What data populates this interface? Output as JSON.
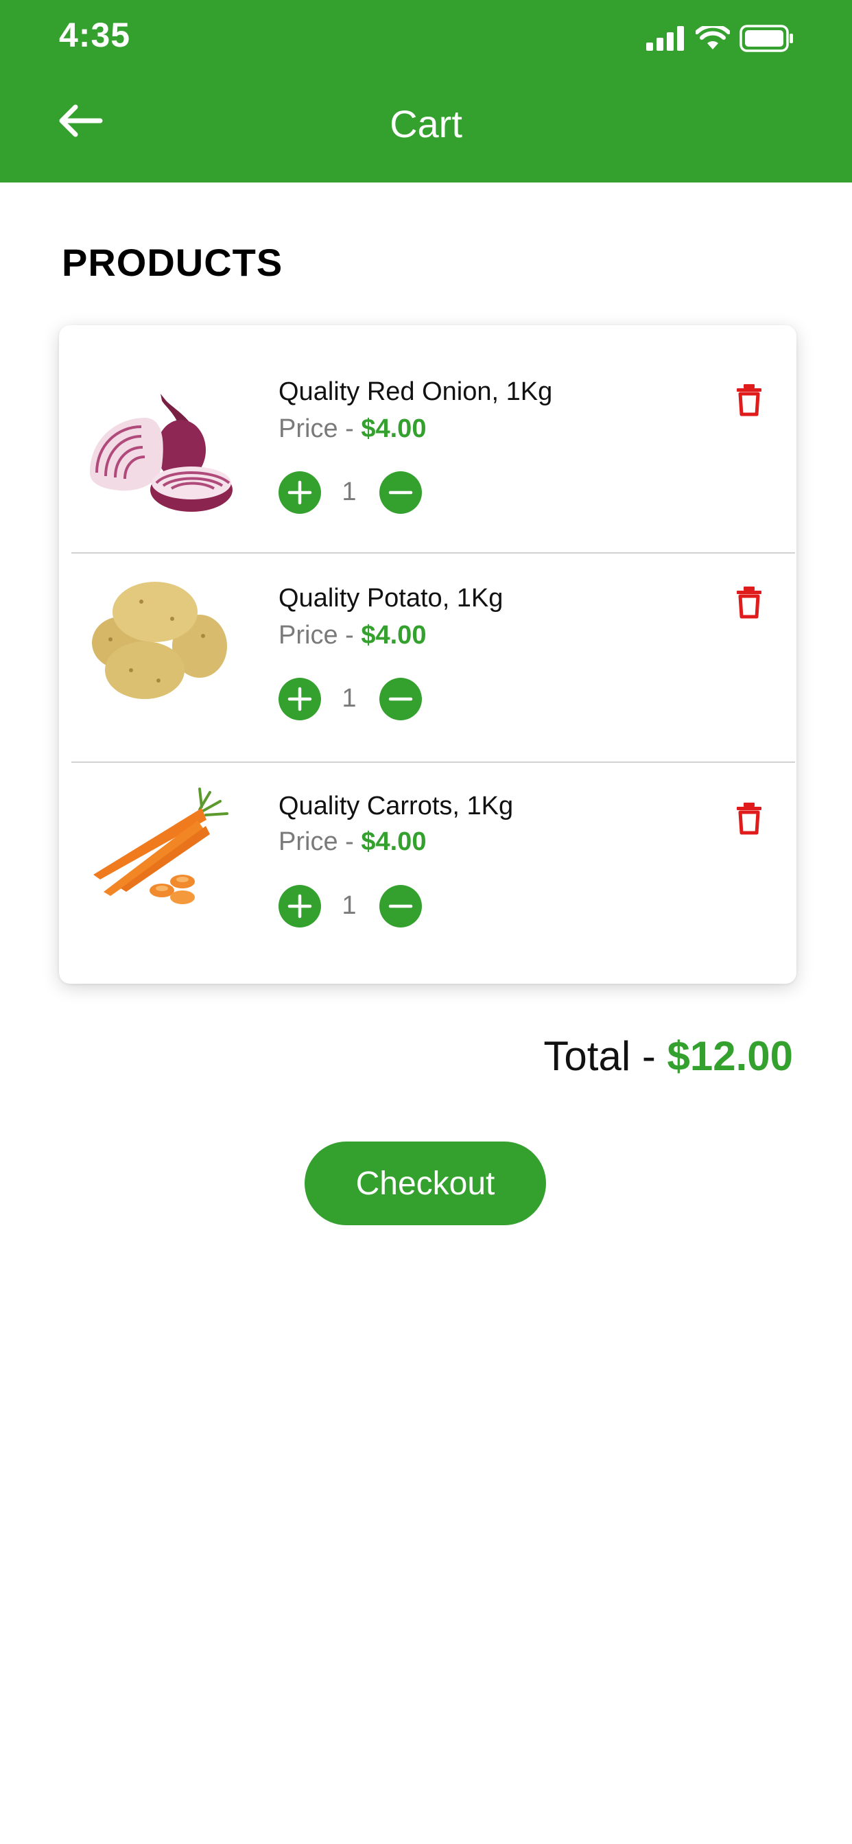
{
  "status_bar": {
    "time": "4:35"
  },
  "header": {
    "title": "Cart",
    "back_icon": "arrow-left-icon"
  },
  "section": {
    "title": "PRODUCTS"
  },
  "products": [
    {
      "name": "Quality Red Onion, 1Kg",
      "price_label": "Price - ",
      "price": "$4.00",
      "quantity": "1",
      "image": "red-onion-image"
    },
    {
      "name": "Quality Potato, 1Kg",
      "price_label": "Price - ",
      "price": "$4.00",
      "quantity": "1",
      "image": "potato-image"
    },
    {
      "name": "Quality Carrots, 1Kg",
      "price_label": "Price - ",
      "price": "$4.00",
      "quantity": "1",
      "image": "carrot-image"
    }
  ],
  "summary": {
    "total_label": "Total - ",
    "total_value": "$12.00"
  },
  "actions": {
    "checkout_label": "Checkout"
  },
  "colors": {
    "brand": "#34a12f",
    "delete": "#e01b1b",
    "muted": "#7a7a7a"
  }
}
